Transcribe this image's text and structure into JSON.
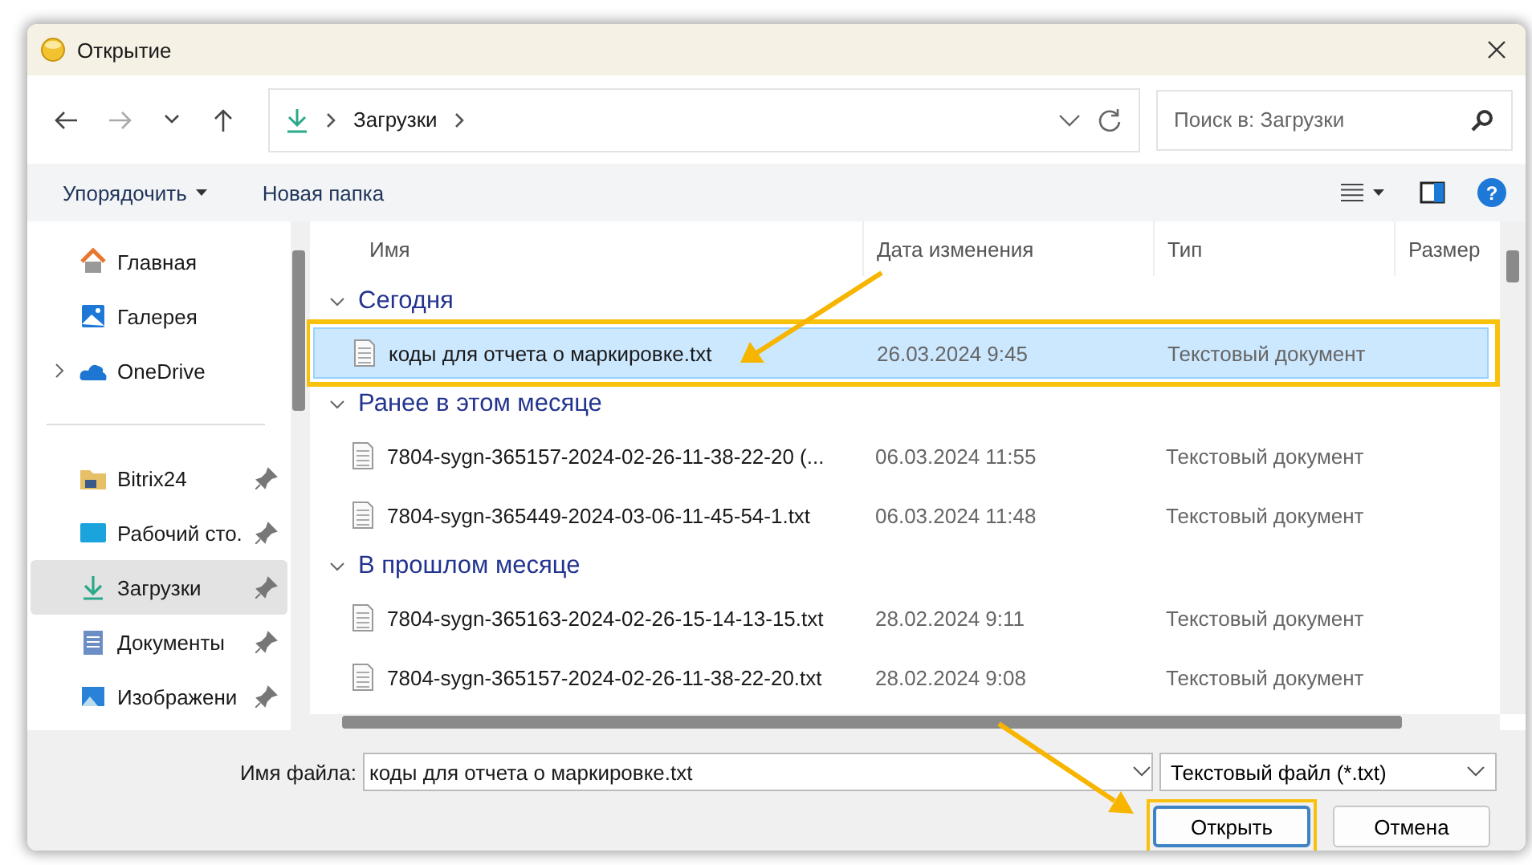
{
  "window": {
    "title": "Открытие"
  },
  "address": {
    "path": [
      "Загрузки"
    ]
  },
  "search": {
    "placeholder": "Поиск в: Загрузки"
  },
  "toolbar": {
    "organize": "Упорядочить",
    "new_folder": "Новая папка",
    "help": "?"
  },
  "sidebar": {
    "items": [
      {
        "label": "Главная",
        "kind": "home",
        "pinned": false,
        "expandable": false,
        "selected": false,
        "separator_before": false
      },
      {
        "label": "Галерея",
        "kind": "gallery",
        "pinned": false,
        "expandable": false,
        "selected": false,
        "separator_before": false
      },
      {
        "label": "OneDrive",
        "kind": "cloud",
        "pinned": false,
        "expandable": true,
        "selected": false,
        "separator_before": false
      },
      {
        "label": "Bitrix24",
        "kind": "folder",
        "pinned": true,
        "expandable": false,
        "selected": false,
        "separator_before": true
      },
      {
        "label": "Рабочий сто.",
        "kind": "desktop",
        "pinned": true,
        "expandable": false,
        "selected": false,
        "separator_before": false
      },
      {
        "label": "Загрузки",
        "kind": "downloads",
        "pinned": true,
        "expandable": false,
        "selected": true,
        "separator_before": false
      },
      {
        "label": "Документы",
        "kind": "documents",
        "pinned": true,
        "expandable": false,
        "selected": false,
        "separator_before": false
      },
      {
        "label": "Изображени",
        "kind": "pictures",
        "pinned": true,
        "expandable": false,
        "selected": false,
        "separator_before": false
      }
    ]
  },
  "table": {
    "columns": [
      "Имя",
      "Дата изменения",
      "Тип",
      "Размер"
    ],
    "groups": [
      {
        "title": "Сегодня",
        "expanded": true,
        "rows": [
          {
            "name": "коды для отчета о маркировке.txt",
            "date": "26.03.2024 9:45",
            "type": "Текстовый документ",
            "selected": true,
            "highlighted": true
          }
        ]
      },
      {
        "title": "Ранее в этом месяце",
        "expanded": true,
        "rows": [
          {
            "name": "7804-sygn-365157-2024-02-26-11-38-22-20 (...",
            "date": "06.03.2024 11:55",
            "type": "Текстовый документ",
            "selected": false,
            "highlighted": false
          },
          {
            "name": "7804-sygn-365449-2024-03-06-11-45-54-1.txt",
            "date": "06.03.2024 11:48",
            "type": "Текстовый документ",
            "selected": false,
            "highlighted": false
          }
        ]
      },
      {
        "title": "В прошлом месяце",
        "expanded": true,
        "rows": [
          {
            "name": "7804-sygn-365163-2024-02-26-15-14-13-15.txt",
            "date": "28.02.2024 9:11",
            "type": "Текстовый документ",
            "selected": false,
            "highlighted": false
          },
          {
            "name": "7804-sygn-365157-2024-02-26-11-38-22-20.txt",
            "date": "28.02.2024 9:08",
            "type": "Текстовый документ",
            "selected": false,
            "highlighted": false
          }
        ]
      }
    ]
  },
  "footer": {
    "filename_label": "Имя файла:",
    "filename": "коды для отчета о маркировке.txt",
    "filetype": "Текстовый файл (*.txt)",
    "buttons": [
      {
        "label": "Открыть",
        "primary": true,
        "highlighted": true
      },
      {
        "label": "Отмена",
        "primary": false,
        "highlighted": false
      }
    ]
  }
}
